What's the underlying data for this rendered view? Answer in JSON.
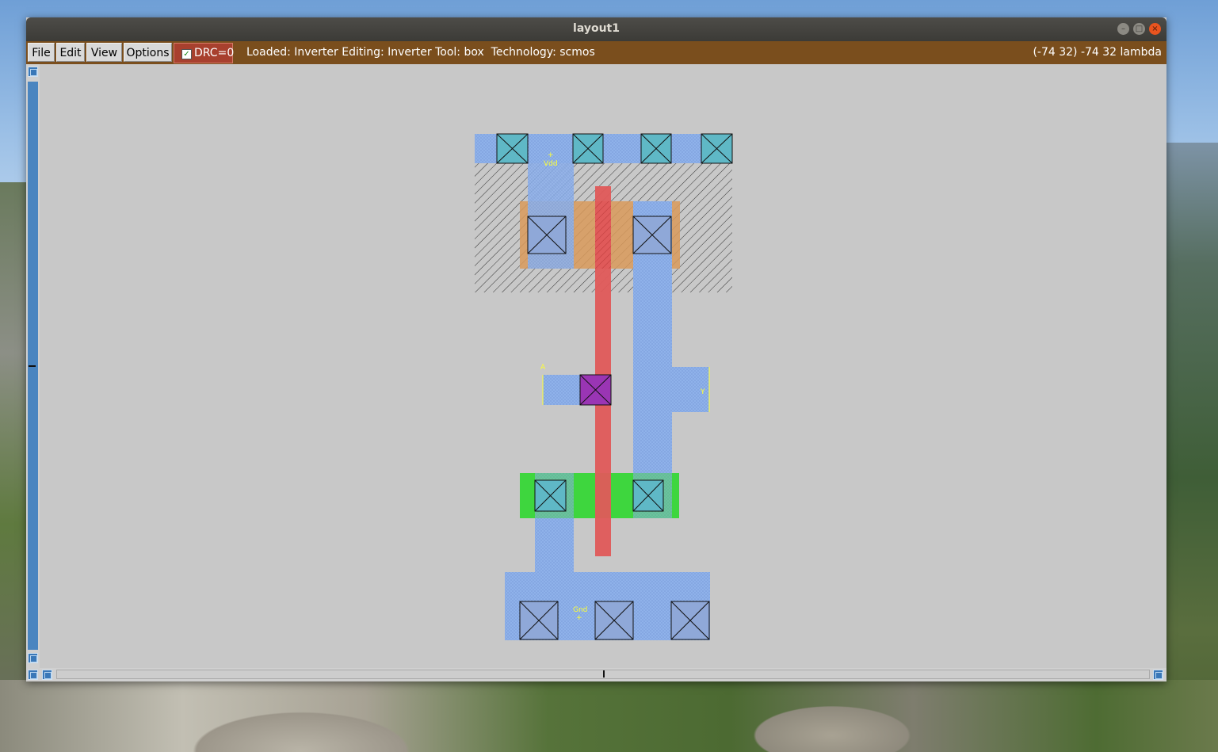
{
  "window": {
    "title": "layout1",
    "controls": {
      "minimize": "–",
      "maximize": "□",
      "close": "×"
    }
  },
  "menubar": {
    "menus": [
      "File",
      "Edit",
      "View",
      "Options"
    ],
    "drc_label": "DRC=0",
    "drc_checked": true,
    "status": "Loaded: Inverter Editing: Inverter Tool: box  Technology: scmos",
    "coordinates": "(-74 32) -74 32 lambda"
  },
  "layout": {
    "labels": {
      "vdd": "Vdd",
      "gnd": "Gnd",
      "input": "A",
      "output": "Y"
    }
  },
  "colors": {
    "menubar": "#7a4e1d",
    "drc_badge": "#a8402e",
    "metal1": "#8fb2ea",
    "poly": "#e05a5a",
    "pdiff": "#d99a5a",
    "ndiff": "#3ed63e",
    "contact": "#5fb8c6",
    "poly_contact": "#9a35b4",
    "label": "#ffff33"
  }
}
